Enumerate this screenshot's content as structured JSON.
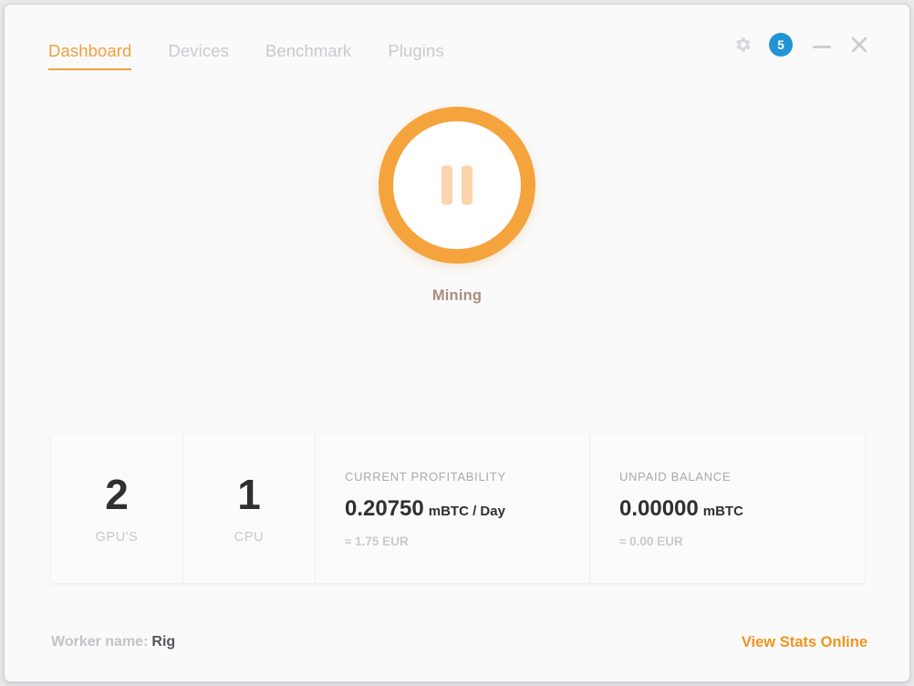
{
  "window": {
    "background": "#fafafa",
    "accent": "#f0a040",
    "badge_color": "#2094d5"
  },
  "header": {
    "tabs": [
      {
        "label": "Dashboard",
        "active": true
      },
      {
        "label": "Devices",
        "active": false
      },
      {
        "label": "Benchmark",
        "active": false
      },
      {
        "label": "Plugins",
        "active": false
      }
    ],
    "controls": {
      "settings_icon": "gear-icon",
      "notification_count": "5",
      "minimize_icon": "minimize-icon",
      "close_icon": "close-icon"
    }
  },
  "mining": {
    "icon": "pause-icon",
    "status_label": "Mining"
  },
  "stats": {
    "counts": [
      {
        "value": "2",
        "label": "GPU'S"
      },
      {
        "value": "1",
        "label": "CPU"
      }
    ],
    "metrics": [
      {
        "title": "CURRENT PROFITABILITY",
        "value": "0.20750",
        "unit": "mBTC / Day",
        "sub": "≈ 1.75 EUR"
      },
      {
        "title": "UNPAID BALANCE",
        "value": "0.00000",
        "unit": "mBTC",
        "sub": "≈ 0.00 EUR"
      }
    ]
  },
  "footer": {
    "worker_label": "Worker name:",
    "worker_value": "Rig",
    "stats_link": "View Stats Online"
  }
}
